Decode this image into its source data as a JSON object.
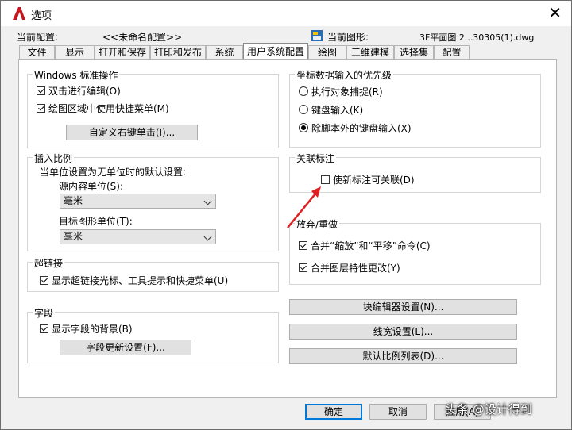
{
  "title": "选项",
  "close_glyph": "✕",
  "current_profile_label": "当前配置:",
  "current_profile_value": "<<未命名配置>>",
  "current_drawing_label": "当前图形:",
  "current_drawing_value": "3F平面图 2...30305(1).dwg",
  "tabs": [
    "文件",
    "显示",
    "打开和保存",
    "打印和发布",
    "系统",
    "用户系统配置",
    "绘图",
    "三维建模",
    "选择集",
    "配置"
  ],
  "active_tab": "用户系统配置",
  "windows_ops": {
    "title": "Windows 标准操作",
    "double_click": {
      "label": "双击进行编辑(O)",
      "checked": true
    },
    "shortcut_menu": {
      "label": "绘图区域中使用快捷菜单(M)",
      "checked": true
    },
    "custom_right_click_button": "自定义右键单击(I)..."
  },
  "insert_scale": {
    "title": "插入比例",
    "desc": "当单位设置为无单位时的默认设置:",
    "source_label": "源内容单位(S):",
    "source_value": "毫米",
    "target_label": "目标图形单位(T):",
    "target_value": "毫米"
  },
  "hyperlink": {
    "title": "超链接",
    "option": {
      "label": "显示超链接光标、工具提示和快捷菜单(U)",
      "checked": true
    }
  },
  "field": {
    "title": "字段",
    "option": {
      "label": "显示字段的背景(B)",
      "checked": true
    },
    "update_button": "字段更新设置(F)..."
  },
  "coord_priority": {
    "title": "坐标数据输入的优先级",
    "options": [
      {
        "label": "执行对象捕捉(R)",
        "checked": false
      },
      {
        "label": "键盘输入(K)",
        "checked": false
      },
      {
        "label": "除脚本外的键盘输入(X)",
        "checked": true
      }
    ]
  },
  "assoc_dim": {
    "title": "关联标注",
    "option": {
      "label": "使新标注可关联(D)",
      "checked": false
    }
  },
  "undo_redo": {
    "title": "放弃/重做",
    "combine_zoom": {
      "label": "合并“缩放”和“平移”命令(C)",
      "checked": true
    },
    "combine_layer": {
      "label": "合并图层特性更改(Y)",
      "checked": true
    }
  },
  "right_buttons": [
    "块编辑器设置(N)...",
    "线宽设置(L)...",
    "默认比例列表(D)..."
  ],
  "bottom_buttons": {
    "ok": "确定",
    "cancel": "取消",
    "apply": "应用(A)"
  },
  "watermark": "头条 @设计得到",
  "colors": {
    "accent": "#0078d7",
    "arrow": "#e02020"
  }
}
